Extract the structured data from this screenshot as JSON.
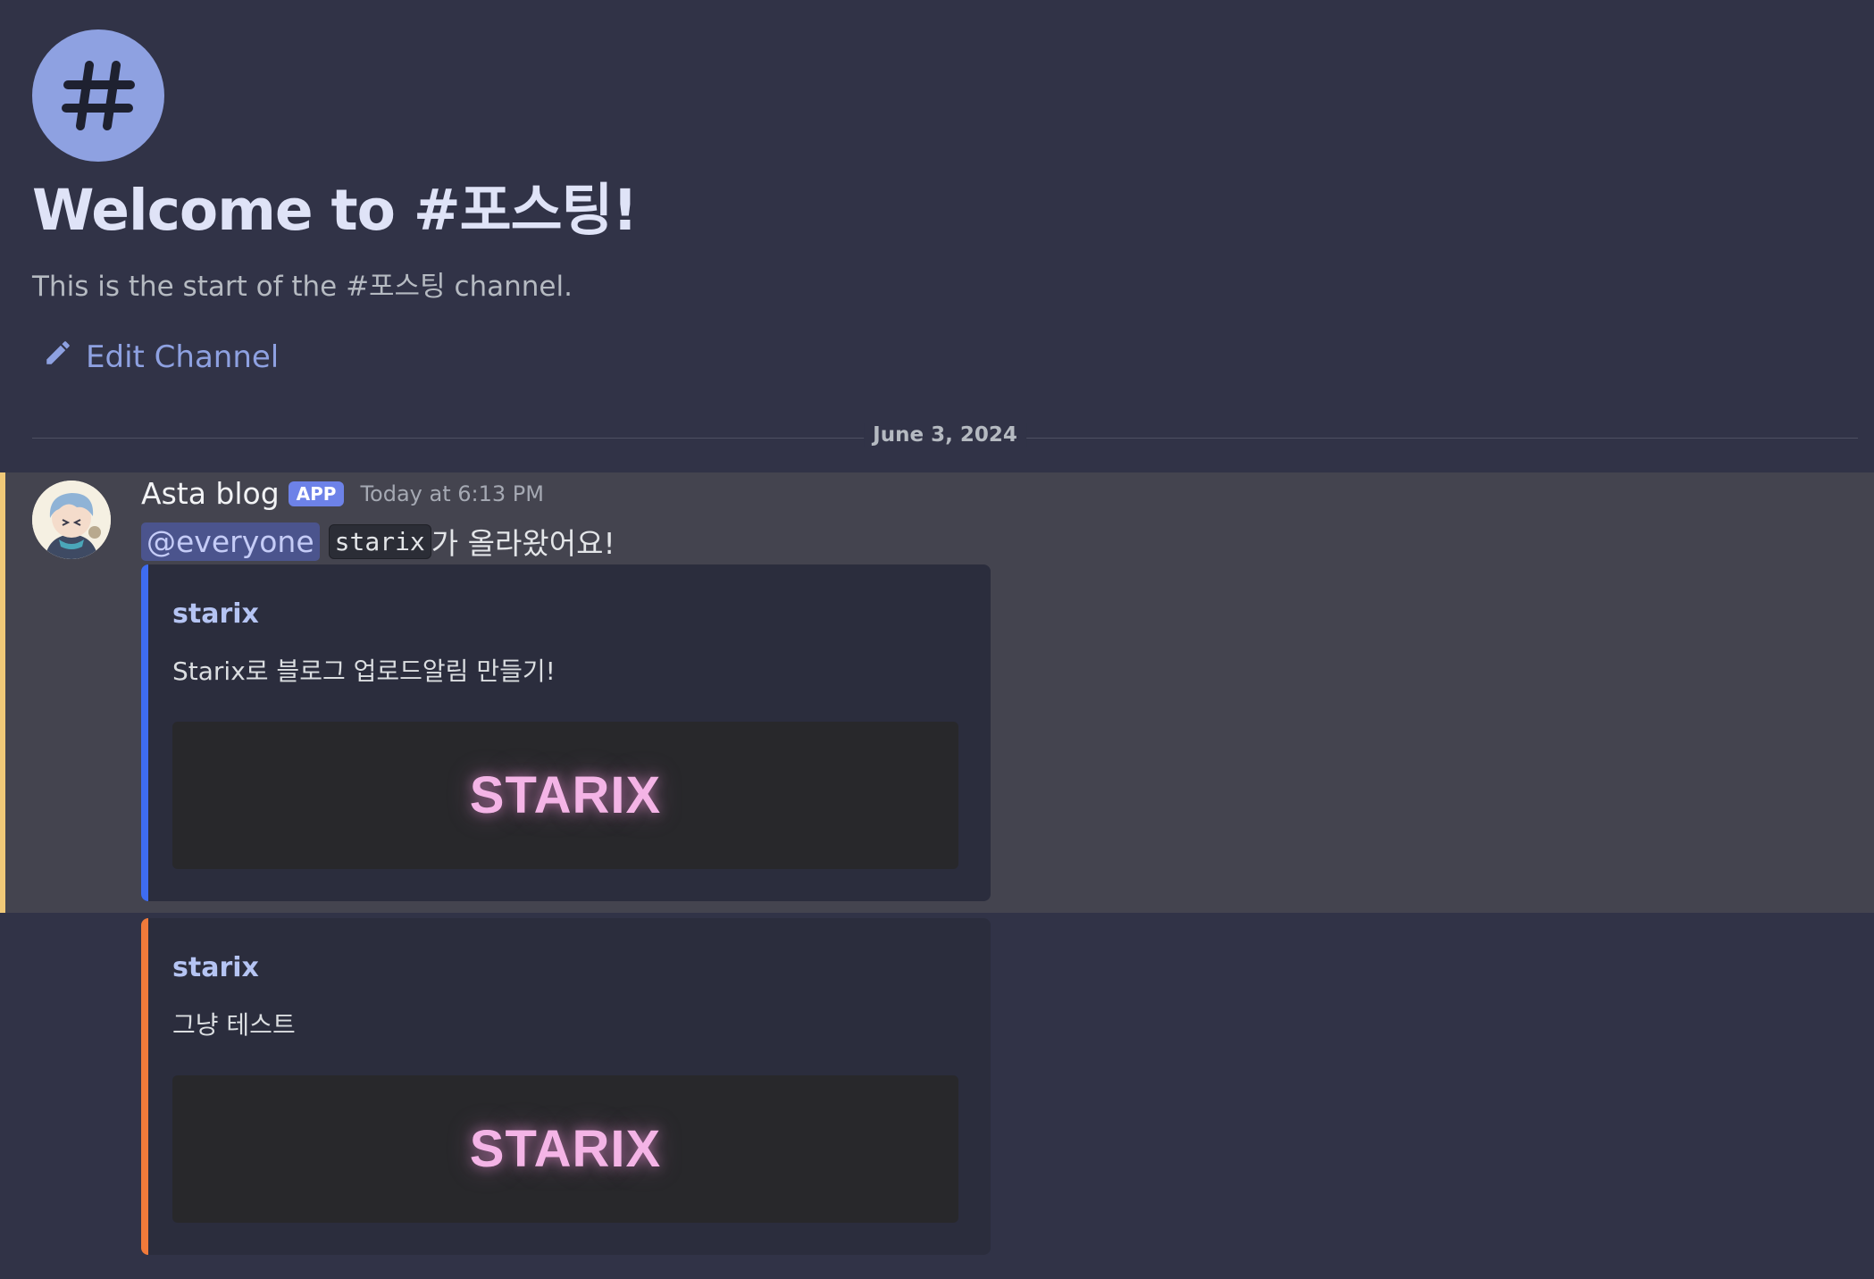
{
  "channel": {
    "welcome_title": "Welcome to #포스팅!",
    "welcome_subtitle": "This is the start of the #포스팅 channel.",
    "edit_label": "Edit Channel"
  },
  "divider": {
    "date": "June 3, 2024"
  },
  "message": {
    "author": "Asta blog",
    "badge": "APP",
    "timestamp": "Today at 6:13 PM",
    "mention": "@everyone",
    "code": "starix",
    "text": "가 올라왔어요!"
  },
  "embeds": [
    {
      "author": "starix",
      "description": "Starix로 블로그 업로드알림 만들기!",
      "image_text": "STARIX",
      "bar_color": "#3e6cf0"
    },
    {
      "author": "starix",
      "description": "그냥 테스트",
      "image_text": "STARIX",
      "bar_color": "#f07a3a"
    }
  ],
  "colors": {
    "background": "#313347",
    "highlight": "#44444f",
    "highlight_bar": "#f0c978",
    "accent": "#8ea1e1"
  }
}
